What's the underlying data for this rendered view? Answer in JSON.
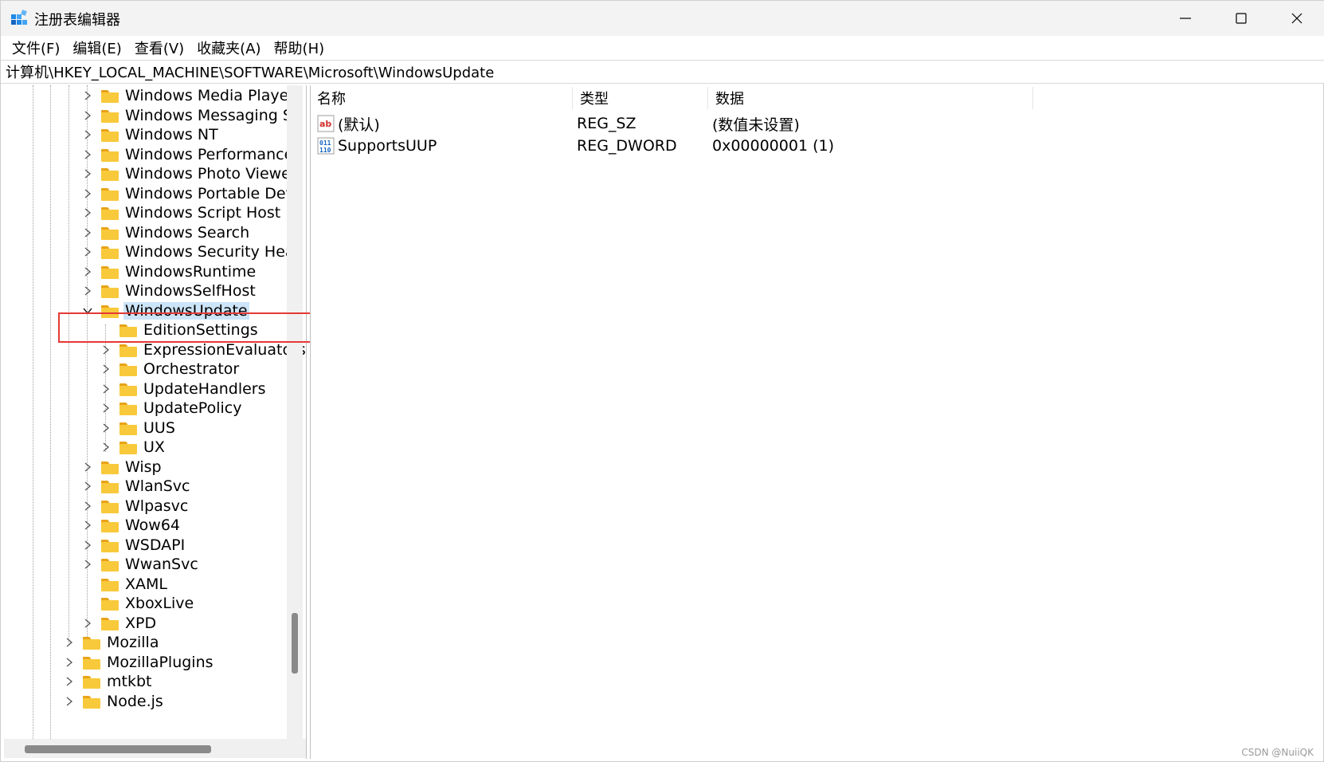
{
  "window": {
    "title": "注册表编辑器",
    "minimize_glyph": "—",
    "maximize_glyph": "☐",
    "close_glyph": "✕"
  },
  "menu": [
    "文件(F)",
    "编辑(E)",
    "查看(V)",
    "收藏夹(A)",
    "帮助(H)"
  ],
  "address": "计算机\\HKEY_LOCAL_MACHINE\\SOFTWARE\\Microsoft\\WindowsUpdate",
  "tree": {
    "level1": [
      {
        "label": "Windows Media Player",
        "expander": "collapsed"
      },
      {
        "label": "Windows Messaging Su",
        "expander": "collapsed"
      },
      {
        "label": "Windows NT",
        "expander": "collapsed"
      },
      {
        "label": "Windows Performance",
        "expander": "collapsed"
      },
      {
        "label": "Windows Photo Viewer",
        "expander": "collapsed"
      },
      {
        "label": "Windows Portable Devi",
        "expander": "collapsed"
      },
      {
        "label": "Windows Script Host",
        "expander": "collapsed"
      },
      {
        "label": "Windows Search",
        "expander": "collapsed"
      },
      {
        "label": "Windows Security Heal",
        "expander": "collapsed"
      },
      {
        "label": "WindowsRuntime",
        "expander": "collapsed"
      },
      {
        "label": "WindowsSelfHost",
        "expander": "collapsed"
      },
      {
        "label": "WindowsUpdate",
        "expander": "expanded",
        "selected": true
      }
    ],
    "children": [
      {
        "label": "EditionSettings",
        "expander": "none"
      },
      {
        "label": "ExpressionEvaluators",
        "expander": "collapsed"
      },
      {
        "label": "Orchestrator",
        "expander": "collapsed"
      },
      {
        "label": "UpdateHandlers",
        "expander": "collapsed"
      },
      {
        "label": "UpdatePolicy",
        "expander": "collapsed"
      },
      {
        "label": "UUS",
        "expander": "collapsed"
      },
      {
        "label": "UX",
        "expander": "collapsed"
      }
    ],
    "level1_after": [
      {
        "label": "Wisp",
        "expander": "collapsed"
      },
      {
        "label": "WlanSvc",
        "expander": "collapsed"
      },
      {
        "label": "Wlpasvc",
        "expander": "collapsed"
      },
      {
        "label": "Wow64",
        "expander": "collapsed"
      },
      {
        "label": "WSDAPI",
        "expander": "collapsed"
      },
      {
        "label": "WwanSvc",
        "expander": "collapsed"
      },
      {
        "label": "XAML",
        "expander": "none"
      },
      {
        "label": "XboxLive",
        "expander": "none"
      },
      {
        "label": "XPD",
        "expander": "collapsed"
      }
    ],
    "level0": [
      {
        "label": "Mozilla",
        "expander": "collapsed"
      },
      {
        "label": "MozillaPlugins",
        "expander": "collapsed"
      },
      {
        "label": "mtkbt",
        "expander": "collapsed"
      },
      {
        "label": "Node.js",
        "expander": "collapsed"
      }
    ]
  },
  "values_table": {
    "headers": {
      "name": "名称",
      "type": "类型",
      "data": "数据"
    },
    "rows": [
      {
        "icon": "string-value-icon",
        "icon_text": "ab",
        "name": "(默认)",
        "type": "REG_SZ",
        "data": "(数值未设置)"
      },
      {
        "icon": "binary-value-icon",
        "icon_text": "011\n110",
        "name": "SupportsUUP",
        "type": "REG_DWORD",
        "data": "0x00000001 (1)"
      }
    ]
  },
  "watermark": "CSDN @NuiiQK",
  "colors": {
    "selection": "#cce4f7",
    "folder": "#f8c93b",
    "highlight_box": "#e53935"
  }
}
